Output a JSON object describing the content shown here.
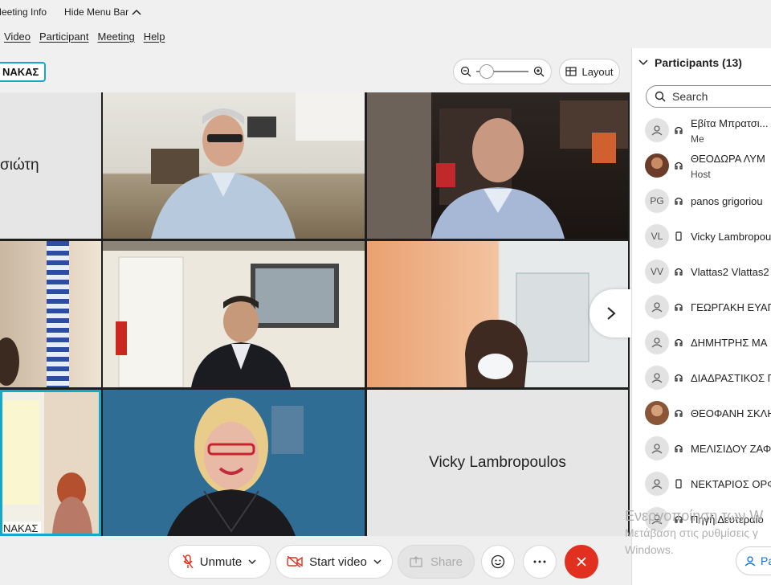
{
  "topbar": {
    "meeting_info": "Meeting Info",
    "hide_menu_bar": "Hide Menu Bar"
  },
  "menu": {
    "items": [
      "Video",
      "Participant",
      "Meeting",
      "Help"
    ]
  },
  "toolbar": {
    "chip_label": "ΝΑΚΑΣ",
    "layout_label": "Layout"
  },
  "grid": {
    "tile_top_left_name": "σιώτη",
    "tile_bottom_left_name": "ΝΑΚΑΣ",
    "tile_bottom_right_name": "Vicky Lambropoulos"
  },
  "controls": {
    "unmute": "Unmute",
    "start_video": "Start video",
    "share": "Share"
  },
  "participants": {
    "header": "Participants (13)",
    "search_placeholder": "Search",
    "items": [
      {
        "name": "Εβίτα Μπρατσι...",
        "sub": "Me",
        "avatar": "person-icon",
        "device": "headset-icon"
      },
      {
        "name": "ΘΕΟΔΩΡΑ ΛΥΜ",
        "sub": "Host",
        "avatar": "photo",
        "device": "headset-icon"
      },
      {
        "name": "panos grigoriou",
        "sub": "",
        "avatar": "PG",
        "device": "headset-icon"
      },
      {
        "name": "Vicky Lambropou",
        "sub": "",
        "avatar": "VL",
        "device": "phone-icon"
      },
      {
        "name": "Vlattas2 Vlattas2",
        "sub": "",
        "avatar": "VV",
        "device": "headset-icon"
      },
      {
        "name": "ΓΕΩΡΓΑΚΗ ΕΥΑΓ",
        "sub": "",
        "avatar": "person-icon",
        "device": "headset-icon"
      },
      {
        "name": "ΔΗΜΗΤΡΗΣ ΜΑ",
        "sub": "",
        "avatar": "person-icon",
        "device": "headset-icon"
      },
      {
        "name": "ΔΙΑΔΡΑΣΤΙΚΟΣ Π",
        "sub": "",
        "avatar": "person-icon",
        "device": "headset-icon"
      },
      {
        "name": "ΘΕΟΦΑΝΗ ΣΚΛΗ",
        "sub": "",
        "avatar": "photo",
        "device": "headset-icon"
      },
      {
        "name": "ΜΕΛΙΣΙΔΟΥ ΖΑΦ",
        "sub": "",
        "avatar": "person-icon",
        "device": "headset-icon"
      },
      {
        "name": "ΝΕΚΤΑΡΙΟΣ ΟΡΦ",
        "sub": "",
        "avatar": "person-icon",
        "device": "phone-icon"
      },
      {
        "name": "Πηγή Δευτεραίο",
        "sub": "",
        "avatar": "person-icon",
        "device": "headset-icon"
      }
    ]
  },
  "watermark": {
    "line1": "Ενεργοποίηση των W",
    "line2": "Μετάβαση στις ρυθμίσεις γ",
    "line3": "Windows."
  },
  "participants_button": {
    "label": "Pa"
  }
}
